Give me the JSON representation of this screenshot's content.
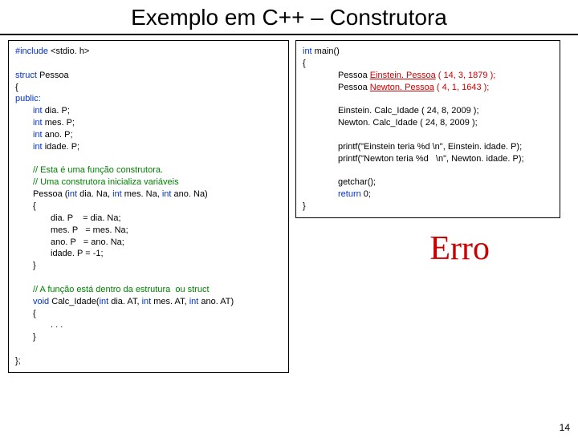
{
  "title": "Exemplo em C++ – Construtora",
  "left": {
    "l1a": "#include ",
    "l1b": "<stdio. h>",
    "l2a": "struct",
    "l2b": " Pessoa",
    "l3": "{",
    "l4": "public:",
    "l5a": "int ",
    "l5b": "dia. P;",
    "l6a": "int ",
    "l6b": "mes. P;",
    "l7a": "int ",
    "l7b": "ano. P;",
    "l8a": "int ",
    "l8b": "idade. P;",
    "c1": "// Esta é uma função construtora.",
    "c2": "// Uma construtora inicializa variáveis",
    "l9a": "Pessoa (",
    "l9b": "int ",
    "l9c": "dia. Na, ",
    "l9d": "int ",
    "l9e": "mes. Na, ",
    "l9f": "int ",
    "l9g": "ano. Na)",
    "l10": "{",
    "l11": "dia. P    = dia. Na;",
    "l12": "mes. P   = mes. Na;",
    "l13": "ano. P   = ano. Na;",
    "l14": "idade. P = -1;",
    "l15": "}",
    "c3": "// A função está dentro da estrutura  ou struct",
    "l16a": "void",
    "l16b": " Calc_Idade(",
    "l16c": "int ",
    "l16d": "dia. AT, ",
    "l16e": "int ",
    "l16f": "mes. AT, ",
    "l16g": "int ",
    "l16h": "ano. AT)",
    "l17": "{",
    "l18": ". . .",
    "l19": "}",
    "l20": "};"
  },
  "right": {
    "r1a": "int",
    "r1b": " main()",
    "r2": "{",
    "r3a": "Pessoa ",
    "r3b": "Einstein.",
    "r3c": " Pessoa",
    "r3d": " ( 14, 3, 1879 );",
    "r4a": "Pessoa ",
    "r4b": "Newton.",
    "r4c": " Pessoa",
    "r4d": " ( 4, 1, 1643 );",
    "r5": "Einstein. Calc_Idade ( 24, 8, 2009 );",
    "r6": "Newton. Calc_Idade ( 24, 8, 2009 );",
    "r7": "printf(\"Einstein teria %d \\n\", Einstein. idade. P);",
    "r8": "printf(\"Newton teria %d   \\n\", Newton. idade. P);",
    "r9": "getchar();",
    "r10a": "return",
    "r10b": " 0;",
    "r11": "}"
  },
  "erro": "Erro",
  "pagenum": "14"
}
